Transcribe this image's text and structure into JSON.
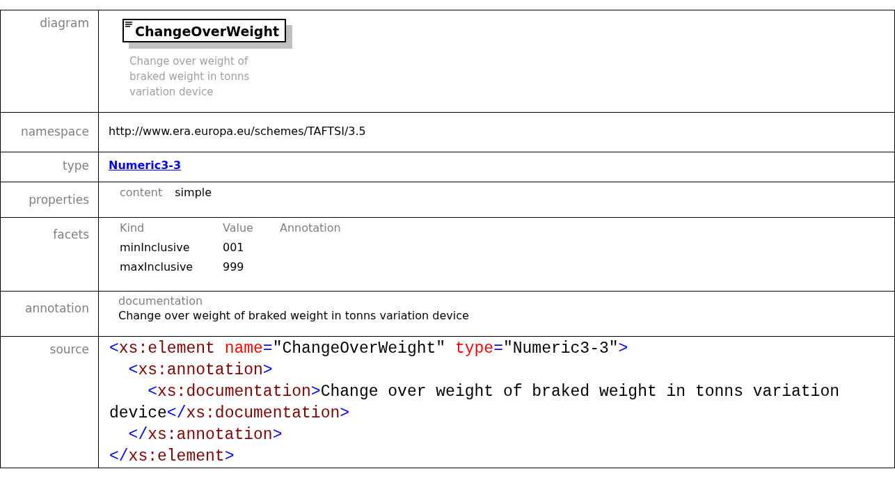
{
  "rows": [
    {
      "label": "diagram",
      "kind": "diagram",
      "element": "ChangeOverWeight",
      "description": "Change over weight of braked weight in tonns variation device"
    },
    {
      "label": "namespace",
      "kind": "text",
      "value": "http://www.era.europa.eu/schemes/TAFTSI/3.5"
    },
    {
      "label": "type",
      "kind": "link",
      "value": "Numeric3-3"
    },
    {
      "label": "properties",
      "kind": "properties",
      "items": [
        {
          "key": "content",
          "value": "simple"
        }
      ]
    },
    {
      "label": "facets",
      "kind": "facets",
      "columns": [
        "Kind",
        "Value",
        "Annotation"
      ],
      "items": [
        {
          "kind": "minInclusive",
          "value": "001"
        },
        {
          "kind": "maxInclusive",
          "value": "999"
        }
      ]
    },
    {
      "label": "annotation",
      "kind": "annotation",
      "heading": "documentation",
      "text": "Change over weight of braked weight in tonns variation device"
    },
    {
      "label": "source",
      "kind": "source",
      "lines": [
        {
          "tokens": [
            {
              "kind": "punct",
              "text": "<"
            },
            {
              "kind": "tag",
              "text": "xs:element"
            },
            {
              "kind": "attr",
              "text": " name"
            },
            {
              "kind": "punct",
              "text": "="
            },
            {
              "kind": "value",
              "text": "\"ChangeOverWeight\""
            },
            {
              "kind": "attr",
              "text": " type"
            },
            {
              "kind": "punct",
              "text": "="
            },
            {
              "kind": "value",
              "text": "\"Numeric3-3\""
            },
            {
              "kind": "punct",
              "text": ">"
            }
          ],
          "children": [
            {
              "tokens": [
                {
                  "kind": "punct",
                  "text": "<"
                },
                {
                  "kind": "tag",
                  "text": "xs:annotation"
                },
                {
                  "kind": "punct",
                  "text": ">"
                }
              ],
              "children": [
                {
                  "tokens": [
                    {
                      "kind": "punct",
                      "text": "<"
                    },
                    {
                      "kind": "tag",
                      "text": "xs:documentation"
                    },
                    {
                      "kind": "punct",
                      "text": ">"
                    },
                    {
                      "kind": "text",
                      "text": "Change over weight of braked weight in tonns variation device"
                    },
                    {
                      "kind": "punct",
                      "text": "</"
                    },
                    {
                      "kind": "tag",
                      "text": "xs:documentation"
                    },
                    {
                      "kind": "punct",
                      "text": ">"
                    }
                  ]
                }
              ]
            },
            {
              "tokens": [
                {
                  "kind": "punct",
                  "text": "</"
                },
                {
                  "kind": "tag",
                  "text": "xs:annotation"
                },
                {
                  "kind": "punct",
                  "text": ">"
                }
              ]
            }
          ]
        },
        {
          "tokens": [
            {
              "kind": "punct",
              "text": "</"
            },
            {
              "kind": "tag",
              "text": "xs:element"
            },
            {
              "kind": "punct",
              "text": ">"
            }
          ]
        }
      ]
    }
  ]
}
